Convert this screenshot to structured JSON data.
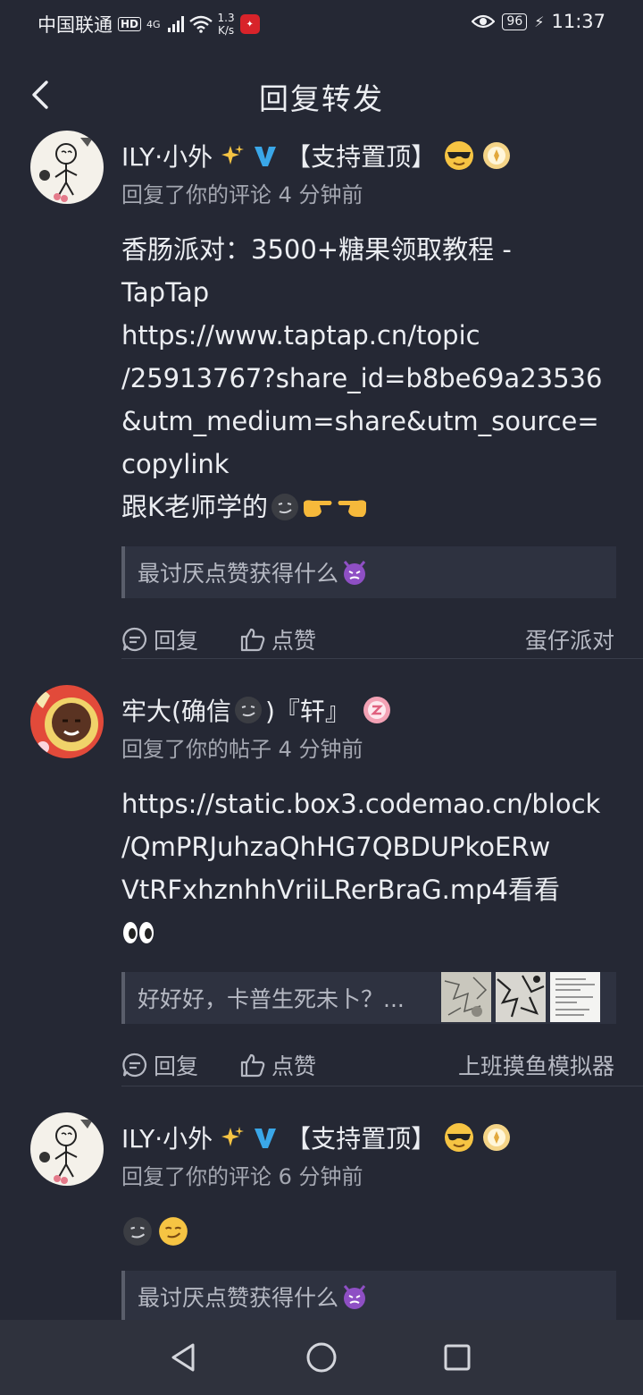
{
  "status_bar": {
    "carrier": "中国联通",
    "hd": "HD",
    "network": "4G",
    "speed_value": "1.3",
    "speed_unit": "K/s",
    "battery": "96",
    "time": "11:37"
  },
  "header": {
    "title": "回复转发"
  },
  "items": [
    {
      "author": "ILY·小外",
      "tag": "【支持置顶】",
      "meta": "回复了你的评论 4 分钟前",
      "body_lines": [
        "香肠派对：3500+糖果领取教程 -",
        "TapTap",
        "https://www.taptap.cn/topic",
        "/25913767?share_id=b8be69a23536",
        "&utm_medium=share&utm_source=",
        "copylink",
        "跟K老师学的"
      ],
      "quote": "最讨厌点赞获得什么",
      "reply_label": "回复",
      "like_label": "点赞",
      "source": "蛋仔派对"
    },
    {
      "author": "牢大(确信",
      "author_suffix": ")『轩』",
      "meta": "回复了你的帖子 4 分钟前",
      "body_lines": [
        "https://static.box3.codemao.cn/block",
        "/QmPRJuhzaQhHG7QBDUPkoERw",
        "VtRFxhznhhVriiLRerBraG.mp4看看",
        ""
      ],
      "quote": "好好好，卡普生死未卜？...",
      "reply_label": "回复",
      "like_label": "点赞",
      "source": "上班摸鱼模拟器"
    },
    {
      "author": "ILY·小外",
      "tag": "【支持置顶】",
      "meta": "回复了你的评论 6 分钟前",
      "quote": "最讨厌点赞获得什么"
    }
  ],
  "colors": {
    "background": "#252834",
    "text": "#eceef2",
    "muted": "#a4a7b1",
    "verified": "#3aa7e8",
    "quote_bg": "#2e3240"
  }
}
